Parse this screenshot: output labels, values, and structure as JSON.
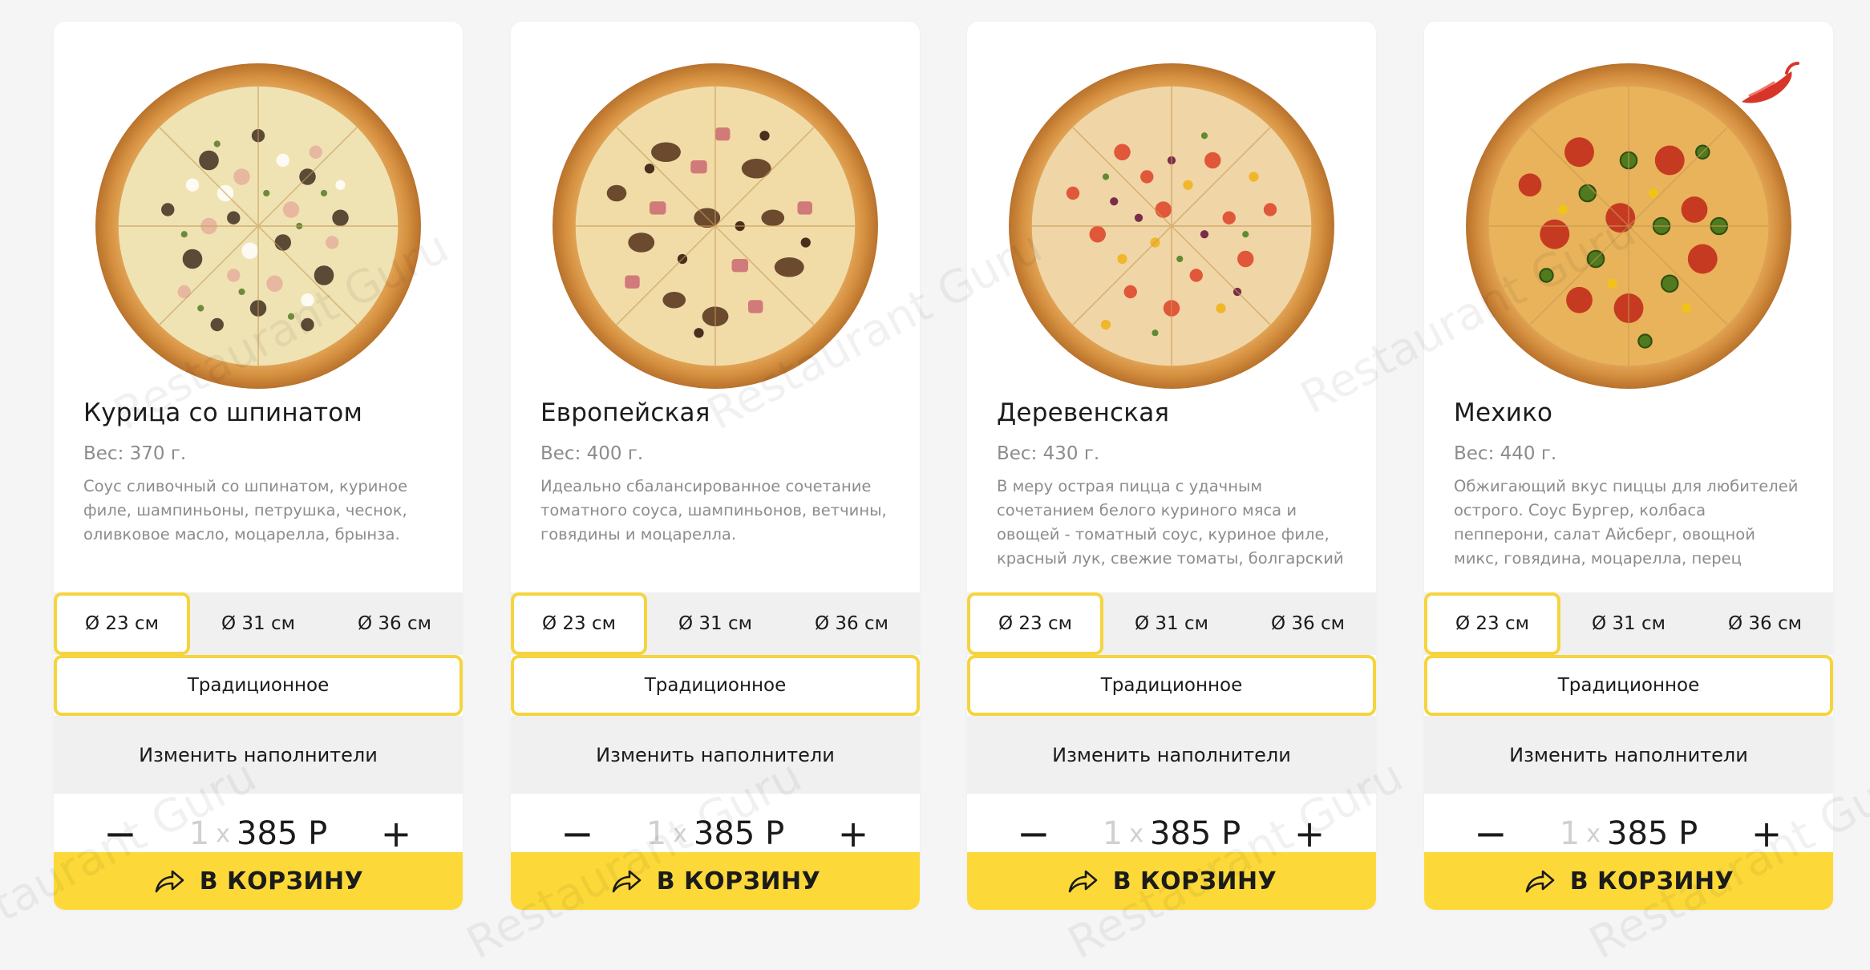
{
  "accent_color": "#fcd939",
  "selected_border_color": "#f5d43f",
  "watermark_text": "Restaurant Guru",
  "products": [
    {
      "title": "Курица со шпинатом",
      "weight": "Вес: 370 г.",
      "description": "Соус сливочный со шпинатом, куриное филе, шампиньоны, петрушка, чеснок, оливковое масло, моцарелла, брынза.",
      "sizes": [
        "Ø 23 см",
        "Ø 31 см",
        "Ø 36 см"
      ],
      "selected_size": "Ø 23 см",
      "crust": "Традиционное",
      "change_toppings": "Изменить наполнители",
      "quantity_minus": "−",
      "quantity": "1",
      "quantity_times": "x",
      "price": "385 Р",
      "quantity_plus": "+",
      "cart_button": "В КОРЗИНУ",
      "pizza_icon": "pizza-chicken-spinach-image"
    },
    {
      "title": "Европейская",
      "weight": "Вес: 400 г.",
      "description": "Идеально сбалансированное сочетание томатного соуса, шампиньонов, ветчины, говядины и моцарелла.",
      "sizes": [
        "Ø 23 см",
        "Ø 31 см",
        "Ø 36 см"
      ],
      "selected_size": "Ø 23 см",
      "crust": "Традиционное",
      "change_toppings": "Изменить наполнители",
      "quantity_minus": "−",
      "quantity": "1",
      "quantity_times": "x",
      "price": "385 Р",
      "quantity_plus": "+",
      "cart_button": "В КОРЗИНУ",
      "pizza_icon": "pizza-european-image"
    },
    {
      "title": "Деревенская",
      "weight": "Вес: 430 г.",
      "description": "В меру острая пицца с удачным сочетанием белого куриного мяса и овощей - томатный соус, куриное филе, красный лук, свежие томаты, болгарский",
      "sizes": [
        "Ø 23 см",
        "Ø 31 см",
        "Ø 36 см"
      ],
      "selected_size": "Ø 23 см",
      "crust": "Традиционное",
      "change_toppings": "Изменить наполнители",
      "quantity_minus": "−",
      "quantity": "1",
      "quantity_times": "x",
      "price": "385 Р",
      "quantity_plus": "+",
      "cart_button": "В КОРЗИНУ",
      "pizza_icon": "pizza-village-image"
    },
    {
      "title": "Мехико",
      "weight": "Вес: 440 г.",
      "description": "Обжигающий вкус пиццы для любителей острого. Соус Бургер, колбаса пепперони, салат Айсберг, овощной микс, говядина, моцарелла, перец халапеньо.",
      "sizes": [
        "Ø 23 см",
        "Ø 31 см",
        "Ø 36 см"
      ],
      "selected_size": "Ø 23 см",
      "crust": "Традиционное",
      "change_toppings": "Изменить наполнители",
      "quantity_minus": "−",
      "quantity": "1",
      "quantity_times": "x",
      "price": "385 Р",
      "quantity_plus": "+",
      "cart_button": "В КОРЗИНУ",
      "pizza_icon": "pizza-mexico-image",
      "badge_icon": "chili-pepper-icon"
    }
  ]
}
